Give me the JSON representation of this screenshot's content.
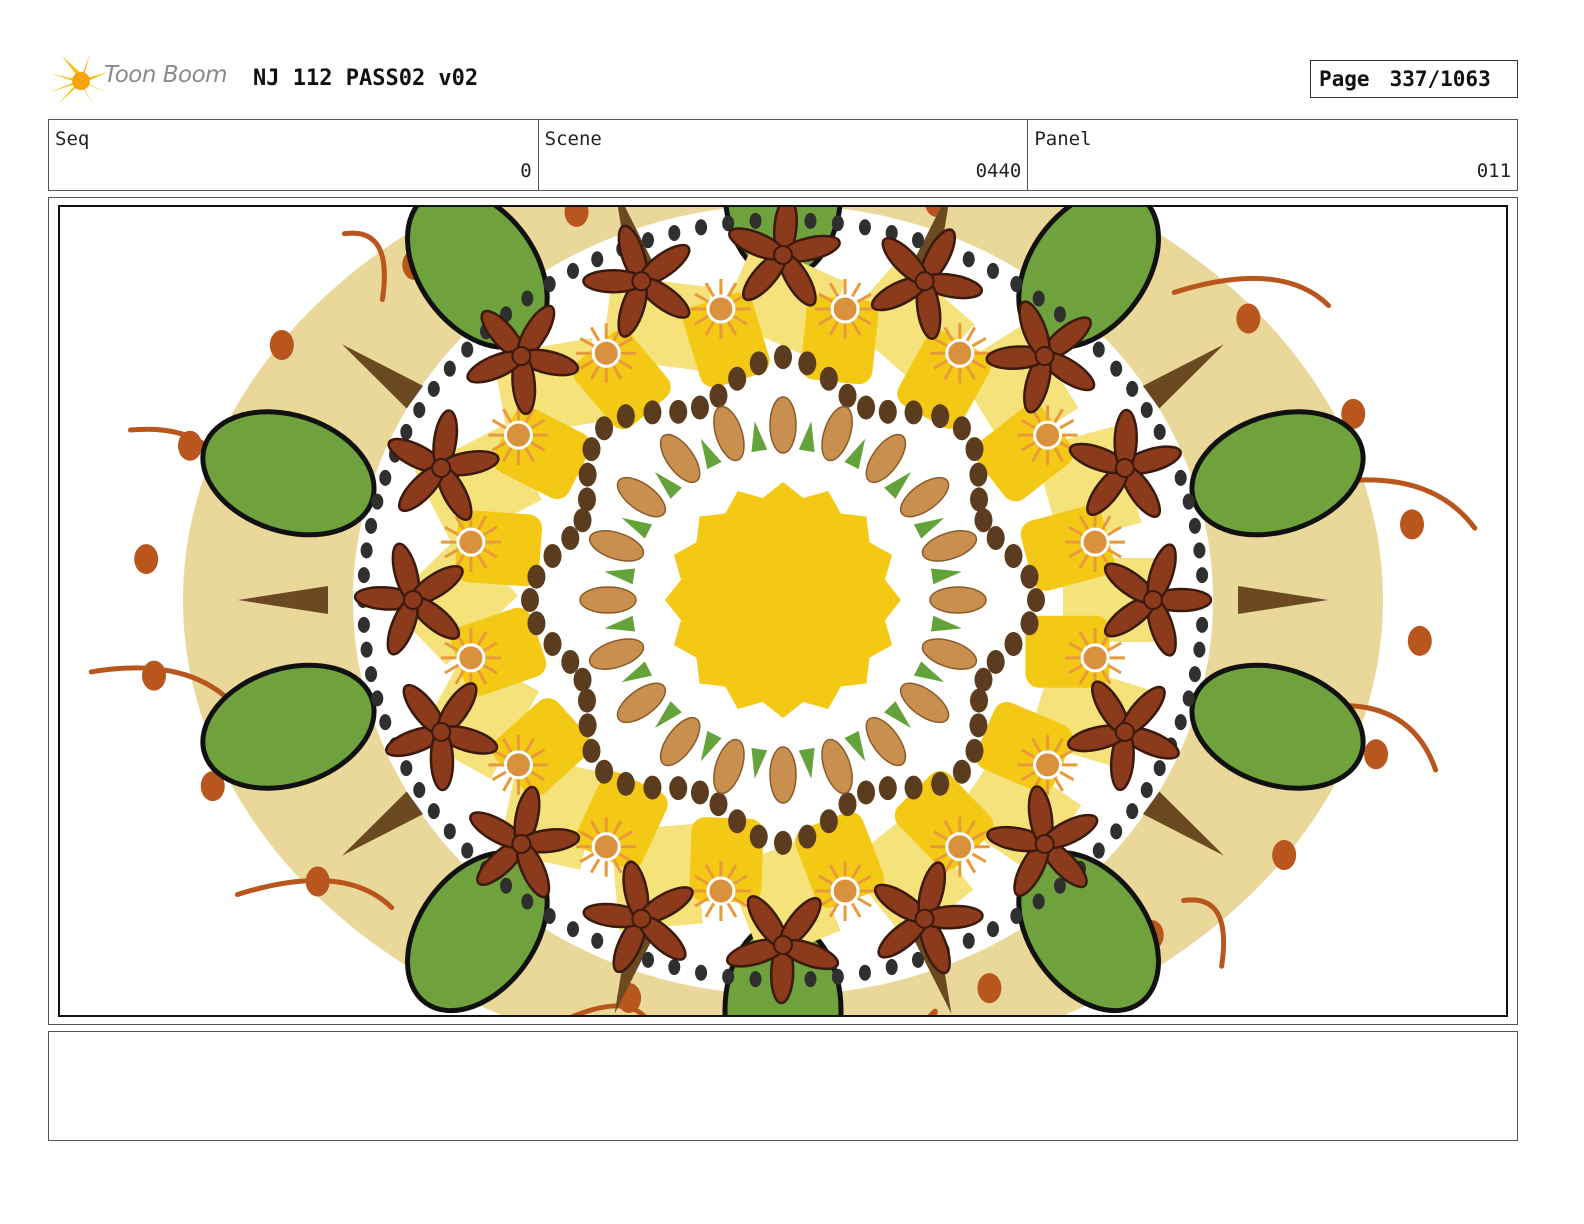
{
  "header": {
    "logo_text": "Toon Boom",
    "title": "NJ 112 PASS02 v02",
    "page_label": "Page",
    "page_value": "337/1063"
  },
  "info": {
    "seq_label": "Seq",
    "seq_value": "0",
    "scene_label": "Scene",
    "scene_value": "0440",
    "panel_label": "Panel",
    "panel_value": "011"
  },
  "notes": {
    "text": ""
  },
  "colors": {
    "sun": "#f4c916",
    "sun_light": "#f6e27a",
    "beige": "#ead79a",
    "leaf": "#6fa23c",
    "leaf_outline": "#111111",
    "anise": "#8b3a1c",
    "anise_outline": "#3a1a0c",
    "almond": "#c98f4f",
    "coffee": "#5c3c1e",
    "dot": "#2f2f2f",
    "orange": "#b8561d",
    "clove": "#6b4a22",
    "sprout": "#63a33a",
    "logo_star": "#f5c21a"
  }
}
